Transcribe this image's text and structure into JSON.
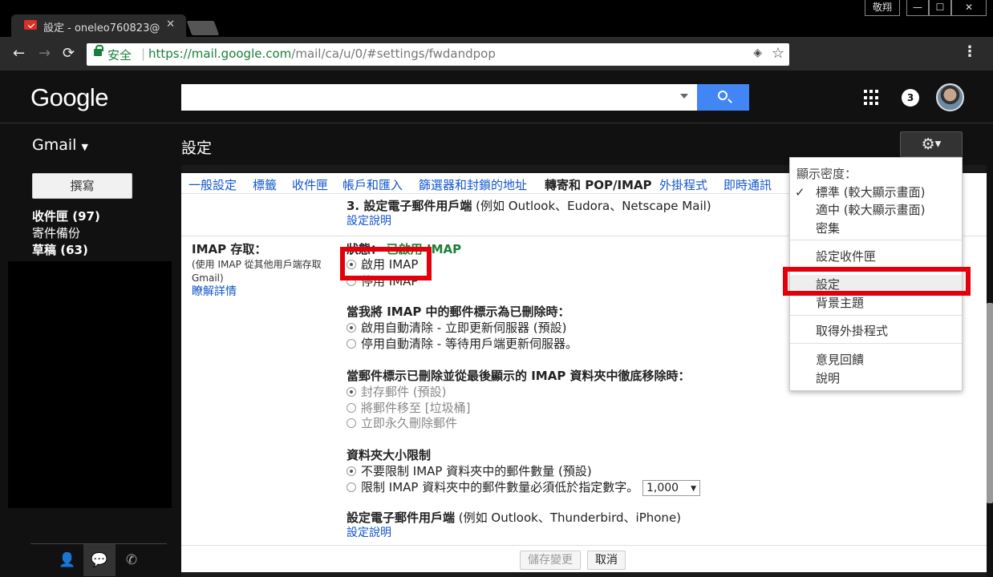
{
  "browser": {
    "tab_title": "設定 - oneleo760823@",
    "tab_close": "✕",
    "window_user": "敬翔",
    "window_min": "—",
    "window_max": "☐",
    "window_close": "✕",
    "nav_back": "←",
    "nav_forward": "→",
    "nav_reload": "⟳",
    "secure_label": "安全",
    "url_base": "https://mail.google.com",
    "url_path": "/mail/ca/u/0/#settings/fwdandpop",
    "menu": "⋮"
  },
  "header": {
    "logo": "Google",
    "notification_count": "3"
  },
  "subheader": {
    "gmail_label": "Gmail",
    "page_title": "設定"
  },
  "sidebar": {
    "compose": "撰寫",
    "items": [
      {
        "label": "收件匣 (97)"
      },
      {
        "label": "寄件備份"
      },
      {
        "label": "草稿 (63)"
      }
    ]
  },
  "settings": {
    "tabs": [
      {
        "label": "一般設定"
      },
      {
        "label": "標籤"
      },
      {
        "label": "收件匣"
      },
      {
        "label": "帳戶和匯入"
      },
      {
        "label": "篩選器和封鎖的地址"
      },
      {
        "label": "轉寄和 POP/IMAP"
      },
      {
        "label": "外掛程式"
      },
      {
        "label": "即時通訊"
      }
    ],
    "pop_step3": "3. 設定電子郵件用戶端",
    "pop_step3_hint": "(例如 Outlook、Eudora、Netscape Mail)",
    "pop_help_link": "設定說明",
    "imap_title": "IMAP 存取：",
    "imap_desc": "(使用 IMAP 從其他用戶端存取 Gmail)",
    "imap_learn_more": "瞭解詳情",
    "status_label": "狀態：",
    "status_value": "已啟用 IMAP",
    "enable_imap": "啟用 IMAP",
    "disable_imap": "停用 IMAP",
    "delete_header": "當我將 IMAP 中的郵件標示為已刪除時：",
    "auto_expunge_on": "啟用自動清除 - 立即更新伺服器 (預設)",
    "auto_expunge_off": "停用自動清除 - 等待用戶端更新伺服器。",
    "expunge_header": "當郵件標示已刪除並從最後顯示的 IMAP 資料夾中徹底移除時：",
    "archive": "封存郵件 (預設)",
    "move_trash": "將郵件移至 [垃圾桶]",
    "delete_forever": "立即永久刪除郵件",
    "folder_limit_header": "資料夾大小限制",
    "no_limit": "不要限制 IMAP 資料夾中的郵件數量 (預設)",
    "limit": "限制 IMAP 資料夾中的郵件數量必須低於指定數字。",
    "limit_value": "1,000",
    "client_setup": "設定電子郵件用戶端",
    "client_setup_hint": "(例如 Outlook、Thunderbird、iPhone)",
    "client_help_link": "設定說明",
    "save": "儲存變更",
    "cancel": "取消"
  },
  "dropdown": {
    "density_header": "顯示密度：",
    "density_options": [
      {
        "label": "標準 (較大顯示畫面)"
      },
      {
        "label": "適中 (較大顯示畫面)"
      },
      {
        "label": "密集"
      }
    ],
    "check": "✓",
    "configure_inbox": "設定收件匣",
    "settings": "設定",
    "themes": "背景主題",
    "get_addons": "取得外掛程式",
    "feedback": "意見回饋",
    "help": "說明"
  },
  "colors": {
    "accent": "#4285f4",
    "annotation": "#e4000b",
    "link": "#1155cc",
    "status_green": "#188038"
  }
}
